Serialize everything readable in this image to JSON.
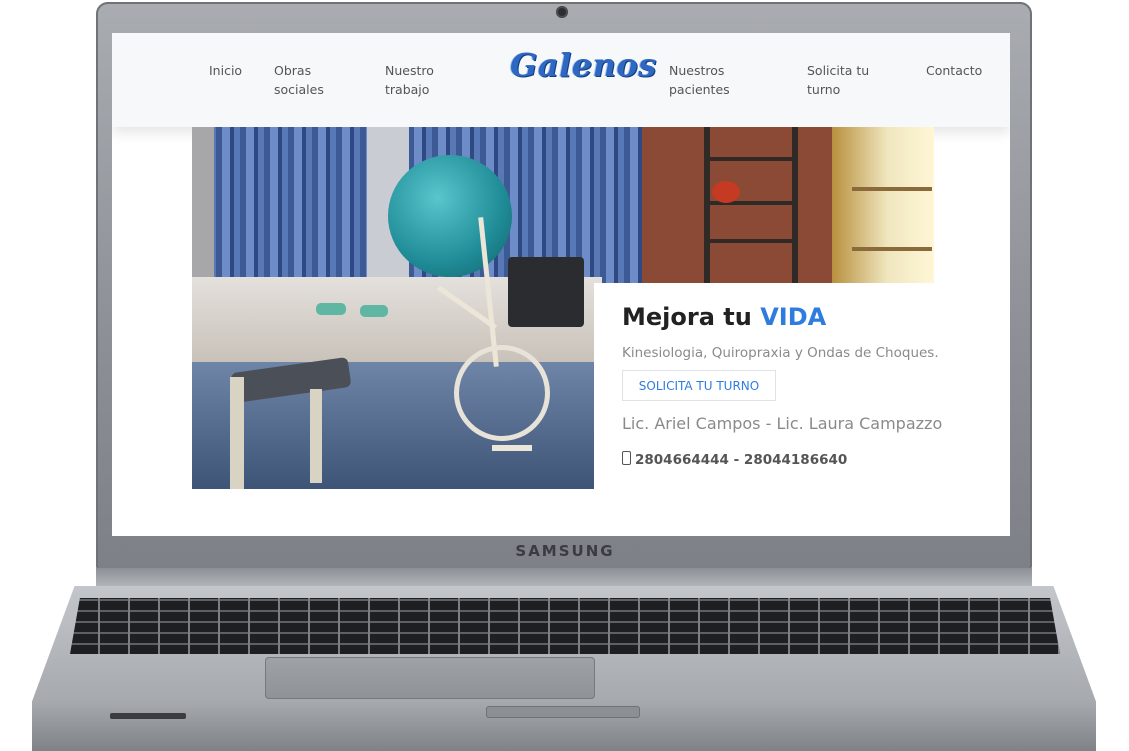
{
  "device": {
    "brand": "SAMSUNG"
  },
  "site": {
    "logo_text": "Galenos",
    "nav_left": [
      {
        "label": "Inicio"
      },
      {
        "label": "Obras\nsociales"
      },
      {
        "label": "Nuestro\ntrabajo"
      }
    ],
    "nav_right": [
      {
        "label": "Nuestros\npacientes"
      },
      {
        "label": "Solicita tu\nturno"
      },
      {
        "label": "Contacto"
      }
    ]
  },
  "hero": {
    "title_main": "Mejora tu ",
    "title_accent": "VIDA",
    "subtitle": "Kinesiologia, Quiropraxia y Ondas de Choques.",
    "cta_label": "SOLICITA TU TURNO",
    "names": "Lic. Ariel Campos - Lic. Laura Campazzo",
    "phones": "2804664444 - 28044186640",
    "phone_icon": "mobile-phone-icon",
    "image": "physiotherapy-gym-photo"
  },
  "colors": {
    "accent": "#2f7ce0",
    "logo": "#2e68c2",
    "nav_bg": "#f7f8f9"
  }
}
